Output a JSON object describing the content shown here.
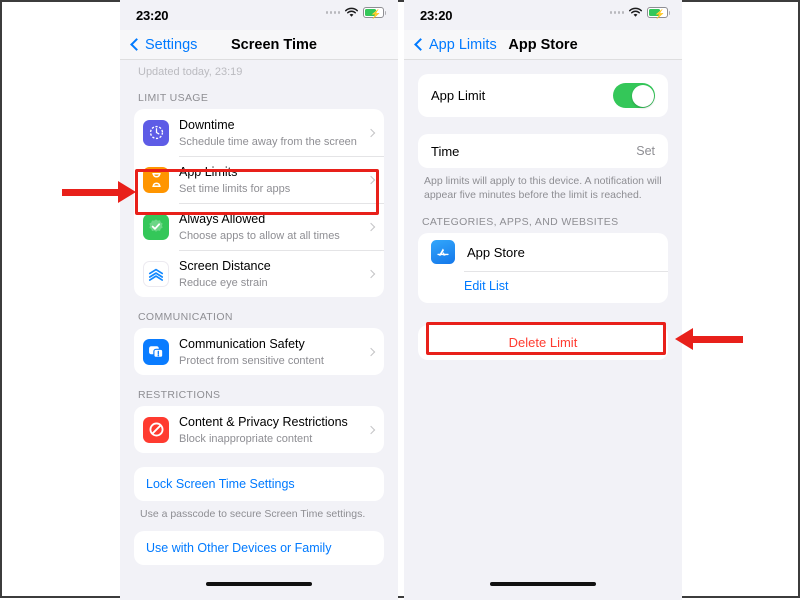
{
  "status": {
    "time": "23:20",
    "wifi_icon": "wifi-icon",
    "battery_icon": "battery-charging-icon"
  },
  "left_phone": {
    "nav": {
      "back_label": "Settings",
      "title": "Screen Time"
    },
    "updated": "Updated today, 23:19",
    "sections": [
      {
        "header": "LIMIT USAGE",
        "rows": [
          {
            "icon": "downtime-icon",
            "title": "Downtime",
            "subtitle": "Schedule time away from the screen"
          },
          {
            "icon": "app-limits-icon",
            "title": "App Limits",
            "subtitle": "Set time limits for apps"
          },
          {
            "icon": "always-allowed-icon",
            "title": "Always Allowed",
            "subtitle": "Choose apps to allow at all times"
          },
          {
            "icon": "screen-distance-icon",
            "title": "Screen Distance",
            "subtitle": "Reduce eye strain"
          }
        ]
      },
      {
        "header": "COMMUNICATION",
        "rows": [
          {
            "icon": "communication-safety-icon",
            "title": "Communication Safety",
            "subtitle": "Protect from sensitive content"
          }
        ]
      },
      {
        "header": "RESTRICTIONS",
        "rows": [
          {
            "icon": "content-privacy-icon",
            "title": "Content & Privacy Restrictions",
            "subtitle": "Block inappropriate content"
          }
        ]
      }
    ],
    "lock_link": "Lock Screen Time Settings",
    "lock_footnote": "Use a passcode to secure Screen Time settings.",
    "family_link": "Use with Other Devices or Family"
  },
  "right_phone": {
    "nav": {
      "back_label": "App Limits",
      "title": "App Store"
    },
    "app_limit": {
      "label": "App Limit",
      "enabled": true
    },
    "time": {
      "label": "Time",
      "value": "Set"
    },
    "footnote": "App limits will apply to this device. A notification will appear five minutes before the limit is reached.",
    "categories_header": "CATEGORIES, APPS, AND WEBSITES",
    "app": {
      "icon": "app-store-icon",
      "name": "App Store"
    },
    "edit_list": "Edit List",
    "delete_limit": "Delete Limit"
  },
  "annotations": {
    "highlight_color": "#e8201a",
    "highlight_app_limits": true,
    "highlight_delete_limit": true,
    "arrow_to_app_limits": true,
    "arrow_to_delete_limit": true
  }
}
